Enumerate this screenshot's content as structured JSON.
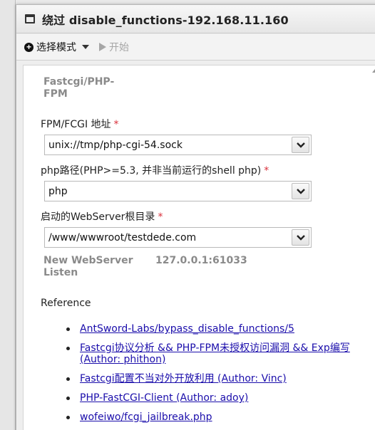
{
  "window": {
    "title": "绕过 disable_functions-192.168.11.160"
  },
  "toolbar": {
    "select_mode_label": "选择模式",
    "start_label": "开始"
  },
  "form": {
    "section_title": "Fastcgi/PHP-FPM",
    "fpm_address": {
      "label": "FPM/FCGI 地址",
      "required_mark": "*",
      "value": "unix://tmp/php-cgi-54.sock"
    },
    "php_path": {
      "label": "php路径(PHP>=5.3, 并非当前运行的shell php)",
      "required_mark": "*",
      "value": "php"
    },
    "webserver_root": {
      "label": "启动的WebServer根目录",
      "required_mark": "*",
      "value": "/www/wwwroot/testdede.com"
    },
    "listen": {
      "label": "New WebServer Listen",
      "value": "127.0.0.1:61033"
    }
  },
  "reference": {
    "label": "Reference",
    "links": [
      "AntSword-Labs/bypass_disable_functions/5",
      "Fastcgi协议分析 && PHP-FPM未授权访问漏洞 && Exp编写 (Author: phithon)",
      "Fastcgi配置不当对外开放利用 (Author: Vinc)",
      "PHP-FastCGI-Client (Author: adoy)",
      "wofeiwo/fcgi_jailbreak.php"
    ]
  },
  "colors": {
    "required": "#d9303b",
    "link": "#1a0dab",
    "section_heading": "#8a8a8a"
  },
  "icons": {
    "window": "window-icon",
    "select_mode": "plus-circle-icon",
    "dropdown": "caret-down-icon",
    "start": "play-icon",
    "combo": "chevron-down-icon"
  }
}
